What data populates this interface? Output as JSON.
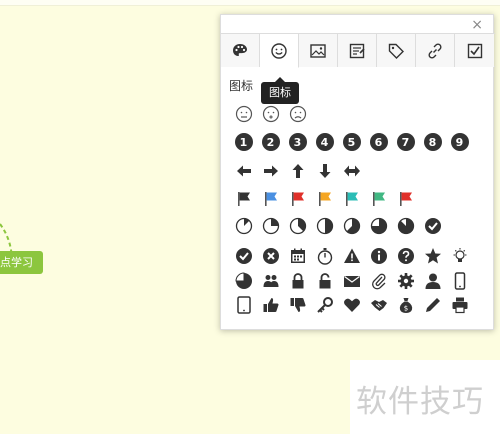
{
  "node": {
    "label": "点学习"
  },
  "panel": {
    "close_label": "×",
    "tabs": [
      {
        "name": "palette-icon"
      },
      {
        "name": "smiley-icon"
      },
      {
        "name": "image-icon"
      },
      {
        "name": "note-icon"
      },
      {
        "name": "tag-icon"
      },
      {
        "name": "link-icon"
      },
      {
        "name": "checkbox-icon"
      }
    ],
    "tooltip": "图标",
    "section_title": "图标",
    "numbers": [
      "1",
      "2",
      "3",
      "4",
      "5",
      "6",
      "7",
      "8",
      "9"
    ],
    "flag_colors": [
      "#333333",
      "#4a90e2",
      "#e0302a",
      "#f5a623",
      "#2bbdb6",
      "#41b883",
      "#e0302a"
    ]
  },
  "watermark": {
    "text": "软件技巧"
  }
}
